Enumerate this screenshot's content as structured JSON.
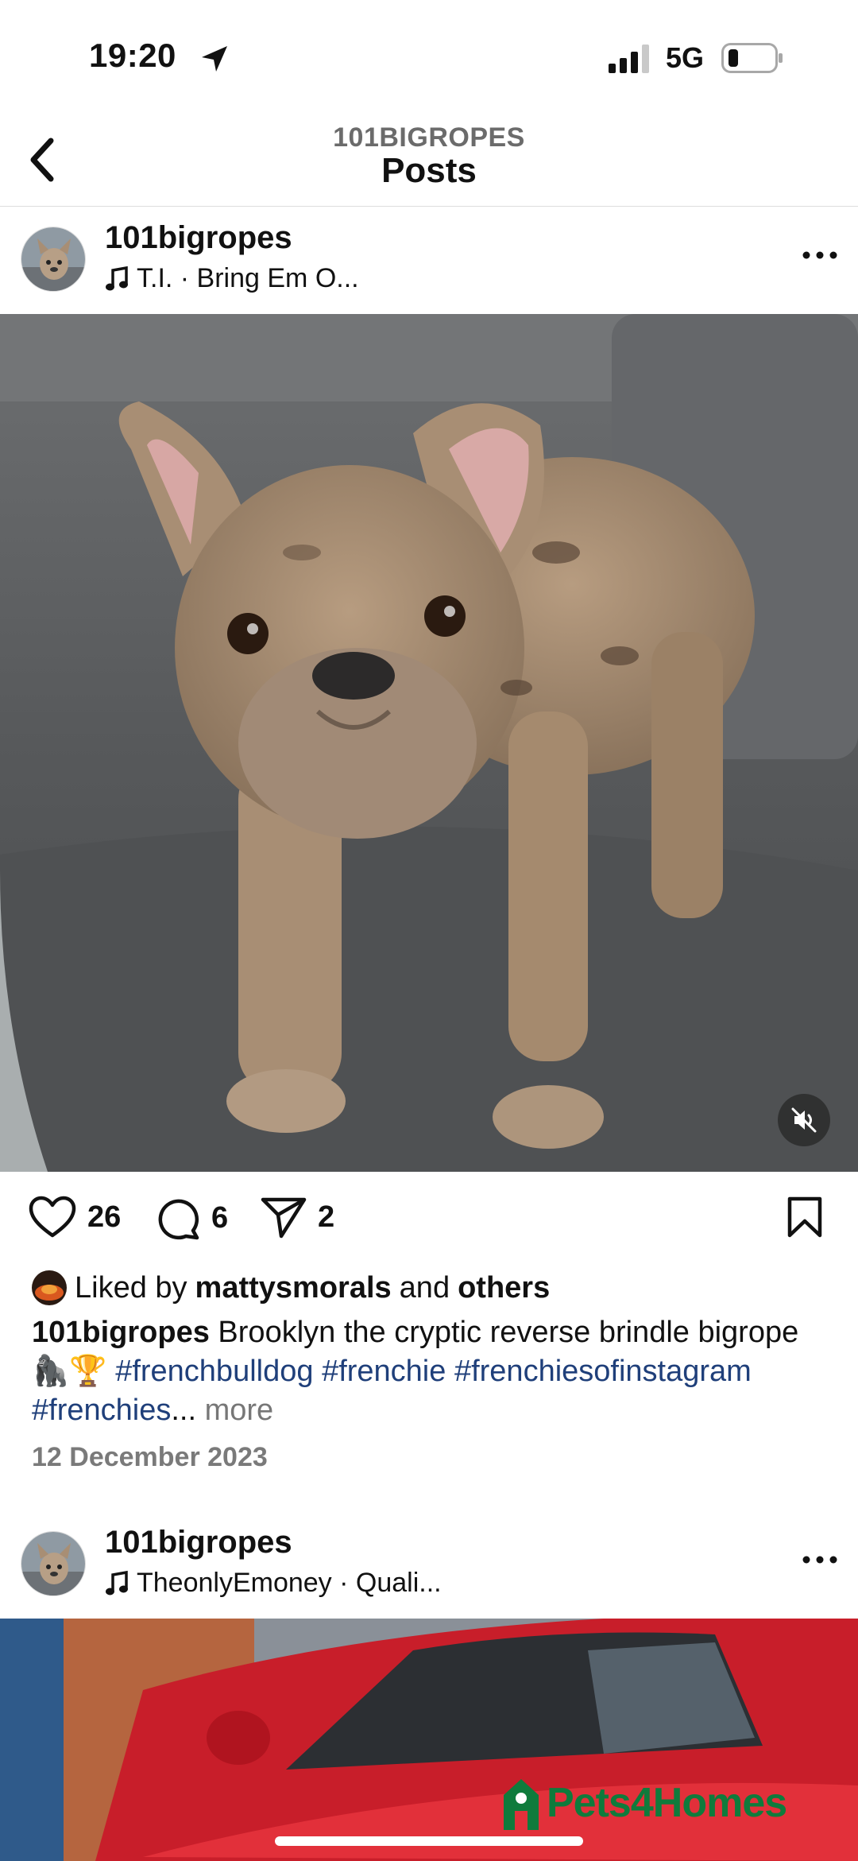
{
  "status_bar": {
    "time": "19:20",
    "network": "5G"
  },
  "header": {
    "account": "101BIGROPES",
    "title": "Posts"
  },
  "post1": {
    "username": "101bigropes",
    "audio": "T.I. · Bring Em O...",
    "likes_count": "26",
    "comments_count": "6",
    "shares_count": "2",
    "liked_by_prefix": "Liked by",
    "liked_by_user": "mattysmorals",
    "liked_by_and": "and",
    "liked_by_others": "others",
    "caption_user": "101bigropes",
    "caption_text": " Brooklyn the cryptic reverse brindle bigrope 🦍🏆 ",
    "hashtags": [
      "#frenchbulldog",
      "#frenchie",
      "#frenchiesofinstagram",
      "#frenchies"
    ],
    "ellipsis": "...",
    "more_label": "more",
    "date": "12 December 2023"
  },
  "post2": {
    "username": "101bigropes",
    "audio": "TheonlyEmoney · Quali..."
  },
  "watermark": "Pets4Homes",
  "colors": {
    "hashtag": "#1f3f7a",
    "watermark": "#0f7b3c"
  }
}
